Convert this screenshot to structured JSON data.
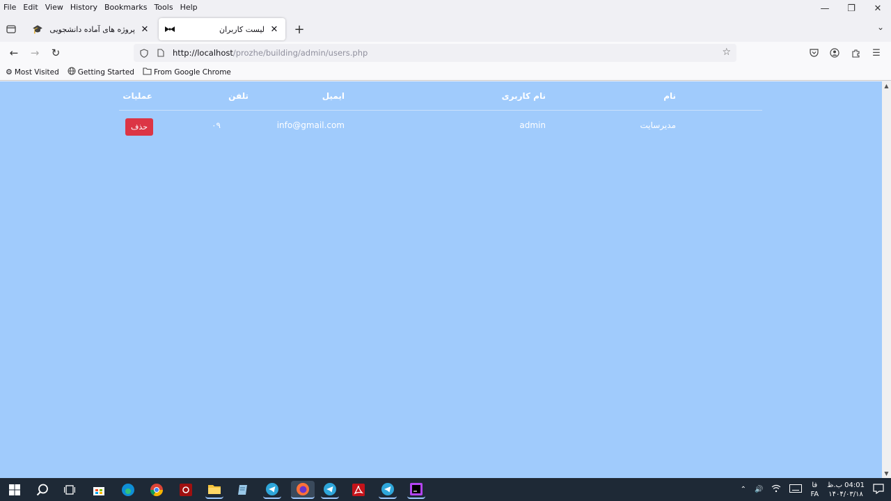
{
  "menu": {
    "items": [
      "File",
      "Edit",
      "View",
      "History",
      "Bookmarks",
      "Tools",
      "Help"
    ]
  },
  "tabs": [
    {
      "title": "پروژه های آماده دانشجویی",
      "active": false
    },
    {
      "title": "لیست کاربران",
      "active": true
    }
  ],
  "nav": {
    "url_host": "http://localhost",
    "url_path": "/prozhe/building/admin/users.php"
  },
  "bookmarks": [
    {
      "label": "Most Visited",
      "icon": "gear-icon"
    },
    {
      "label": "Getting Started",
      "icon": "globe-icon"
    },
    {
      "label": "From Google Chrome",
      "icon": "folder-icon"
    }
  ],
  "table": {
    "headers": {
      "name": "نام",
      "username": "نام کاربری",
      "email": "ایمیل",
      "phone": "تلفن",
      "actions": "عملیات"
    },
    "rows": [
      {
        "name": "مدیرسایت",
        "username": "admin",
        "email": "info@gmail.com",
        "phone": "۰۹",
        "delete_label": "حذف"
      }
    ]
  },
  "colors": {
    "page_bg": "#a0cbfc",
    "delete_button": "#dc3545"
  },
  "taskbar": {
    "lang_top": "فا",
    "lang_bottom": "FA",
    "time": "04:01 ب.ظ",
    "date": "۱۴۰۴/۰۳/۱۸"
  }
}
